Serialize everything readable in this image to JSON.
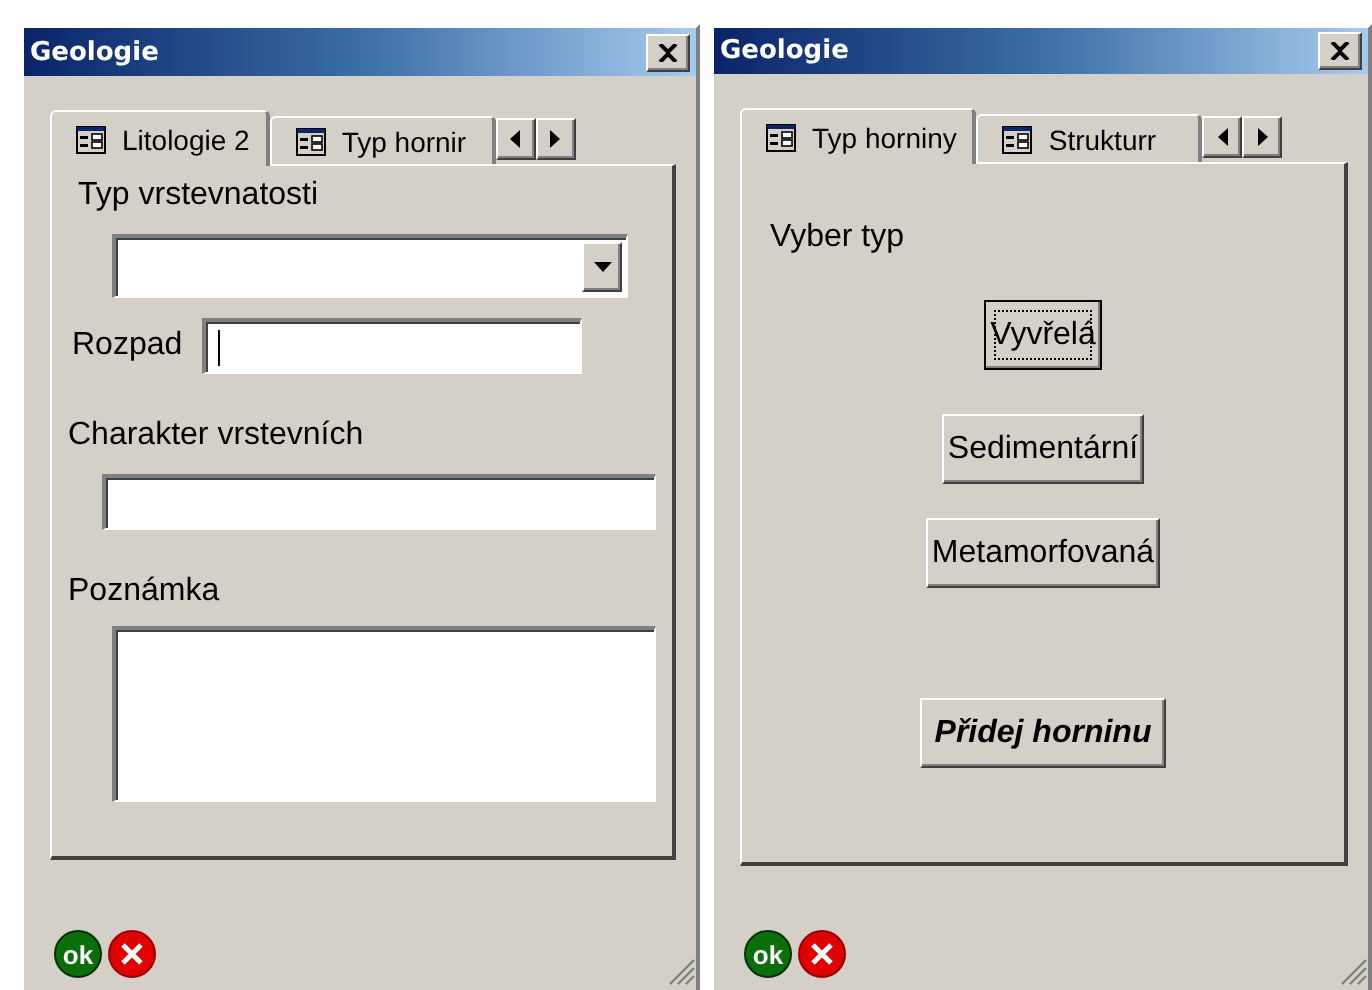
{
  "windows": [
    {
      "title": "Geologie",
      "ok": "ok",
      "tabs": [
        {
          "label": "Litologie 2",
          "selected": true
        },
        {
          "label": "Typ hornir",
          "selected": false
        }
      ],
      "items": [
        {
          "kind": "label",
          "text": "Typ vrstevnatosti"
        },
        {
          "kind": "dropdown"
        },
        {
          "kind": "field-row",
          "label": "Rozpad",
          "focused": true
        },
        {
          "kind": "label",
          "text": "Charakter vrstevních"
        },
        {
          "kind": "field"
        },
        {
          "kind": "label",
          "text": "Poznámka"
        },
        {
          "kind": "textarea"
        }
      ]
    },
    {
      "title": "Geologie",
      "ok": "ok",
      "tabs": [
        {
          "label": "Typ horniny",
          "selected": true
        },
        {
          "label": "Strukturr",
          "selected": false
        }
      ],
      "items": [
        {
          "kind": "caption",
          "text": "Vyber typ"
        },
        {
          "kind": "button",
          "text": "Vyvřelá",
          "focused": true
        },
        {
          "kind": "button",
          "text": "Sedimentární",
          "focused": false
        },
        {
          "kind": "button",
          "text": "Metamorfovaná",
          "focused": false
        },
        {
          "kind": "strong-button",
          "text": "Přidej horninu",
          "focused": false
        }
      ]
    }
  ]
}
